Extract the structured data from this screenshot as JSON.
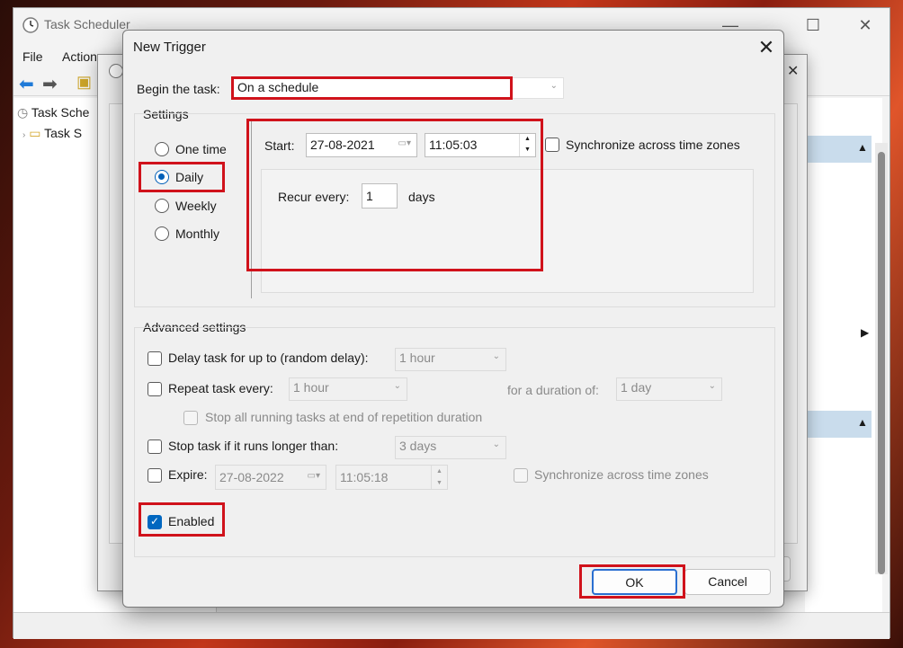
{
  "app": {
    "title": "Task Scheduler",
    "menu": [
      "File",
      "Action"
    ]
  },
  "tree": {
    "items": [
      "Task Sche",
      "Task S"
    ]
  },
  "trigger_dialog": {
    "title": "New Trigger",
    "close_glyph": "✕",
    "begin_label": "Begin the task:",
    "begin_value": "On a schedule",
    "settings": {
      "label": "Settings",
      "options": [
        "One time",
        "Daily",
        "Weekly",
        "Monthly"
      ],
      "selected": "Daily",
      "start_label": "Start:",
      "start_date": "27-08-2021",
      "start_time": "11:05:03",
      "sync_label": "Synchronize across time zones",
      "recur_label": "Recur every:",
      "recur_value": "1",
      "recur_unit": "days"
    },
    "advanced": {
      "label": "Advanced settings",
      "delay_label": "Delay task for up to (random delay):",
      "delay_value": "1 hour",
      "repeat_label": "Repeat task every:",
      "repeat_value": "1 hour",
      "duration_label": "for a duration of:",
      "duration_value": "1 day",
      "stop_all_label": "Stop all running tasks at end of repetition duration",
      "stop_longer_label": "Stop task if it runs longer than:",
      "stop_longer_value": "3 days",
      "expire_label": "Expire:",
      "expire_date": "27-08-2022",
      "expire_time": "11:05:18",
      "expire_sync_label": "Synchronize across time zones",
      "enabled_label": "Enabled"
    },
    "ok_label": "OK",
    "cancel_label": "Cancel"
  },
  "colors": {
    "accent": "#005fb8",
    "highlight": "#d0121b"
  }
}
